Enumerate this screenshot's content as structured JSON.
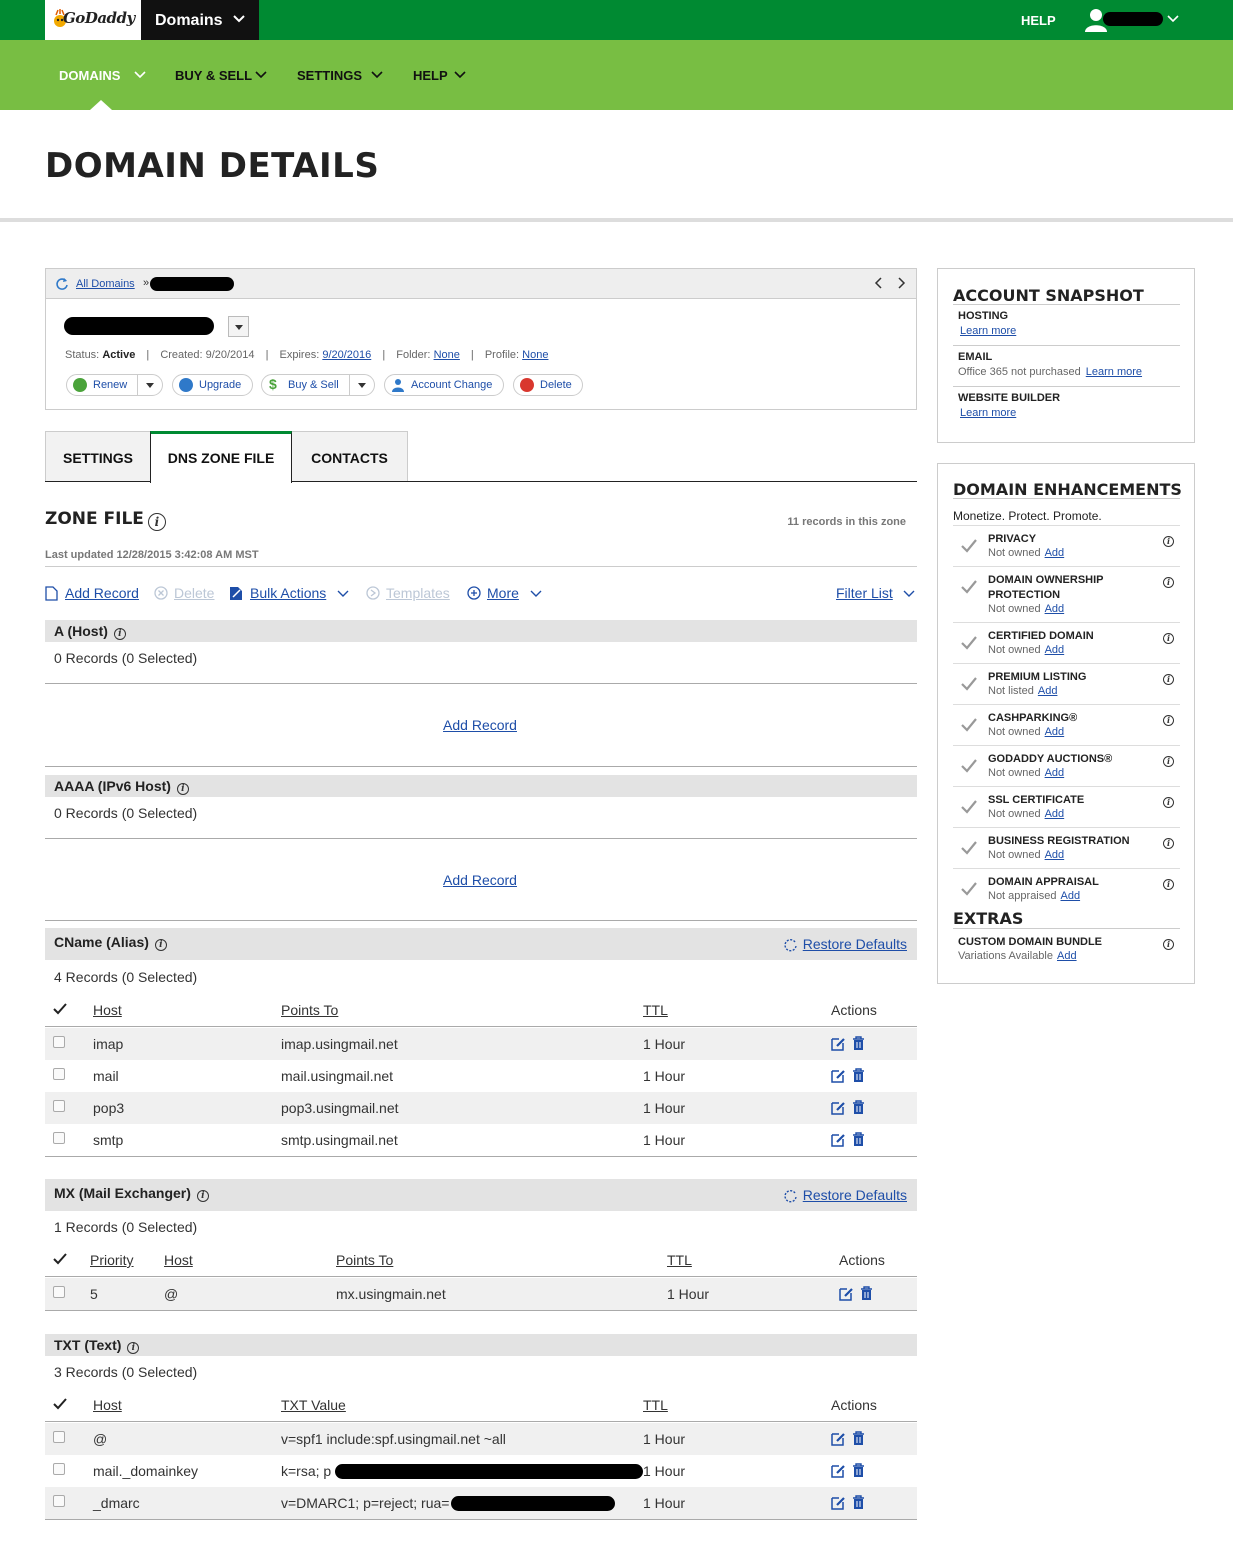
{
  "topbar": {
    "logo": "GoDaddy",
    "product": "Domains",
    "help": "HELP"
  },
  "nav": [
    {
      "label": "DOMAINS"
    },
    {
      "label": "BUY & SELL"
    },
    {
      "label": "SETTINGS"
    },
    {
      "label": "HELP"
    }
  ],
  "page_title": "DOMAIN DETAILS",
  "domain": {
    "all_domains": "All Domains",
    "raquo": "»",
    "status_label": "Status:",
    "status": "Active",
    "created_label": "Created:",
    "created": "9/20/2014",
    "expires_label": "Expires:",
    "expires": "9/20/2016",
    "folder_label": "Folder:",
    "folder": "None",
    "profile_label": "Profile:",
    "profile": "None",
    "sep": "|",
    "actions": {
      "renew": "Renew",
      "upgrade": "Upgrade",
      "buysell": "Buy & Sell",
      "account_change": "Account Change",
      "delete": "Delete"
    },
    "colors": {
      "renew": "#4aa33a",
      "upgrade": "#2f79c9",
      "buysell": "#4aa33a",
      "account": "#2f79c9",
      "delete": "#d9372e"
    }
  },
  "tabs": {
    "settings": "SETTINGS",
    "dns": "DNS ZONE FILE",
    "contacts": "CONTACTS"
  },
  "zone": {
    "title": "ZONE FILE",
    "record_count": "11 records in this zone",
    "last_updated": "Last updated 12/28/2015 3:42:08 AM MST",
    "toolbar": {
      "add": "Add Record",
      "delete": "Delete",
      "bulk": "Bulk Actions",
      "templates": "Templates",
      "more": "More",
      "filter": "Filter List"
    },
    "restore": "Restore Defaults",
    "add_record": "Add Record",
    "a": {
      "title": "A (Host)",
      "count": "0 Records (0 Selected)"
    },
    "aaaa": {
      "title": "AAAA (IPv6 Host)",
      "count": "0 Records (0 Selected)"
    },
    "cname": {
      "title": "CName (Alias)",
      "count": "4 Records (0 Selected)",
      "headers": {
        "host": "Host",
        "points": "Points To",
        "ttl": "TTL",
        "actions": "Actions"
      },
      "rows": [
        {
          "host": "imap",
          "points": "imap.usingmail.net",
          "ttl": "1 Hour"
        },
        {
          "host": "mail",
          "points": "mail.usingmail.net",
          "ttl": "1 Hour"
        },
        {
          "host": "pop3",
          "points": "pop3.usingmail.net",
          "ttl": "1 Hour"
        },
        {
          "host": "smtp",
          "points": "smtp.usingmail.net",
          "ttl": "1 Hour"
        }
      ]
    },
    "mx": {
      "title": "MX (Mail Exchanger)",
      "count": "1 Records (0 Selected)",
      "headers": {
        "priority": "Priority",
        "host": "Host",
        "points": "Points To",
        "ttl": "TTL",
        "actions": "Actions"
      },
      "rows": [
        {
          "priority": "5",
          "host": "@",
          "points": "mx.usingmain.net",
          "ttl": "1 Hour"
        }
      ]
    },
    "txt": {
      "title": "TXT (Text)",
      "count": "3 Records (0 Selected)",
      "headers": {
        "host": "Host",
        "value": "TXT Value",
        "ttl": "TTL",
        "actions": "Actions"
      },
      "rows": [
        {
          "host": "@",
          "value": "v=spf1 include:spf.usingmail.net ~all",
          "ttl": "1 Hour"
        },
        {
          "host": "mail._domainkey",
          "value": "k=rsa; p",
          "ttl": "1 Hour"
        },
        {
          "host": "_dmarc",
          "value": "v=DMARC1; p=reject; rua=",
          "ttl": "1 Hour"
        }
      ]
    }
  },
  "snapshot": {
    "title": "ACCOUNT SNAPSHOT",
    "learn_more": "Learn more",
    "hosting": "HOSTING",
    "email": "EMAIL",
    "email_sub": "Office 365 not purchased",
    "builder": "WEBSITE BUILDER"
  },
  "enhancements": {
    "title": "DOMAIN ENHANCEMENTS",
    "tagline": "Monetize. Protect. Promote.",
    "add": "Add",
    "items": [
      {
        "label": "PRIVACY",
        "status": "Not owned"
      },
      {
        "label": "DOMAIN OWNERSHIP PROTECTION",
        "status": "Not owned"
      },
      {
        "label": "CERTIFIED DOMAIN",
        "status": "Not owned"
      },
      {
        "label": "PREMIUM LISTING",
        "status": "Not listed"
      },
      {
        "label": "CASHPARKING®",
        "status": "Not owned"
      },
      {
        "label": "GODADDY AUCTIONS®",
        "status": "Not owned"
      },
      {
        "label": "SSL CERTIFICATE",
        "status": "Not owned"
      },
      {
        "label": "BUSINESS REGISTRATION",
        "status": "Not owned"
      },
      {
        "label": "DOMAIN APPRAISAL",
        "status": "Not appraised"
      }
    ],
    "extras_title": "EXTRAS",
    "extras": {
      "label": "CUSTOM DOMAIN BUNDLE",
      "status": "Variations Available"
    }
  },
  "colors": {
    "topbar": "#008a32",
    "navbar": "#78be43",
    "link": "#1e4ea8"
  }
}
